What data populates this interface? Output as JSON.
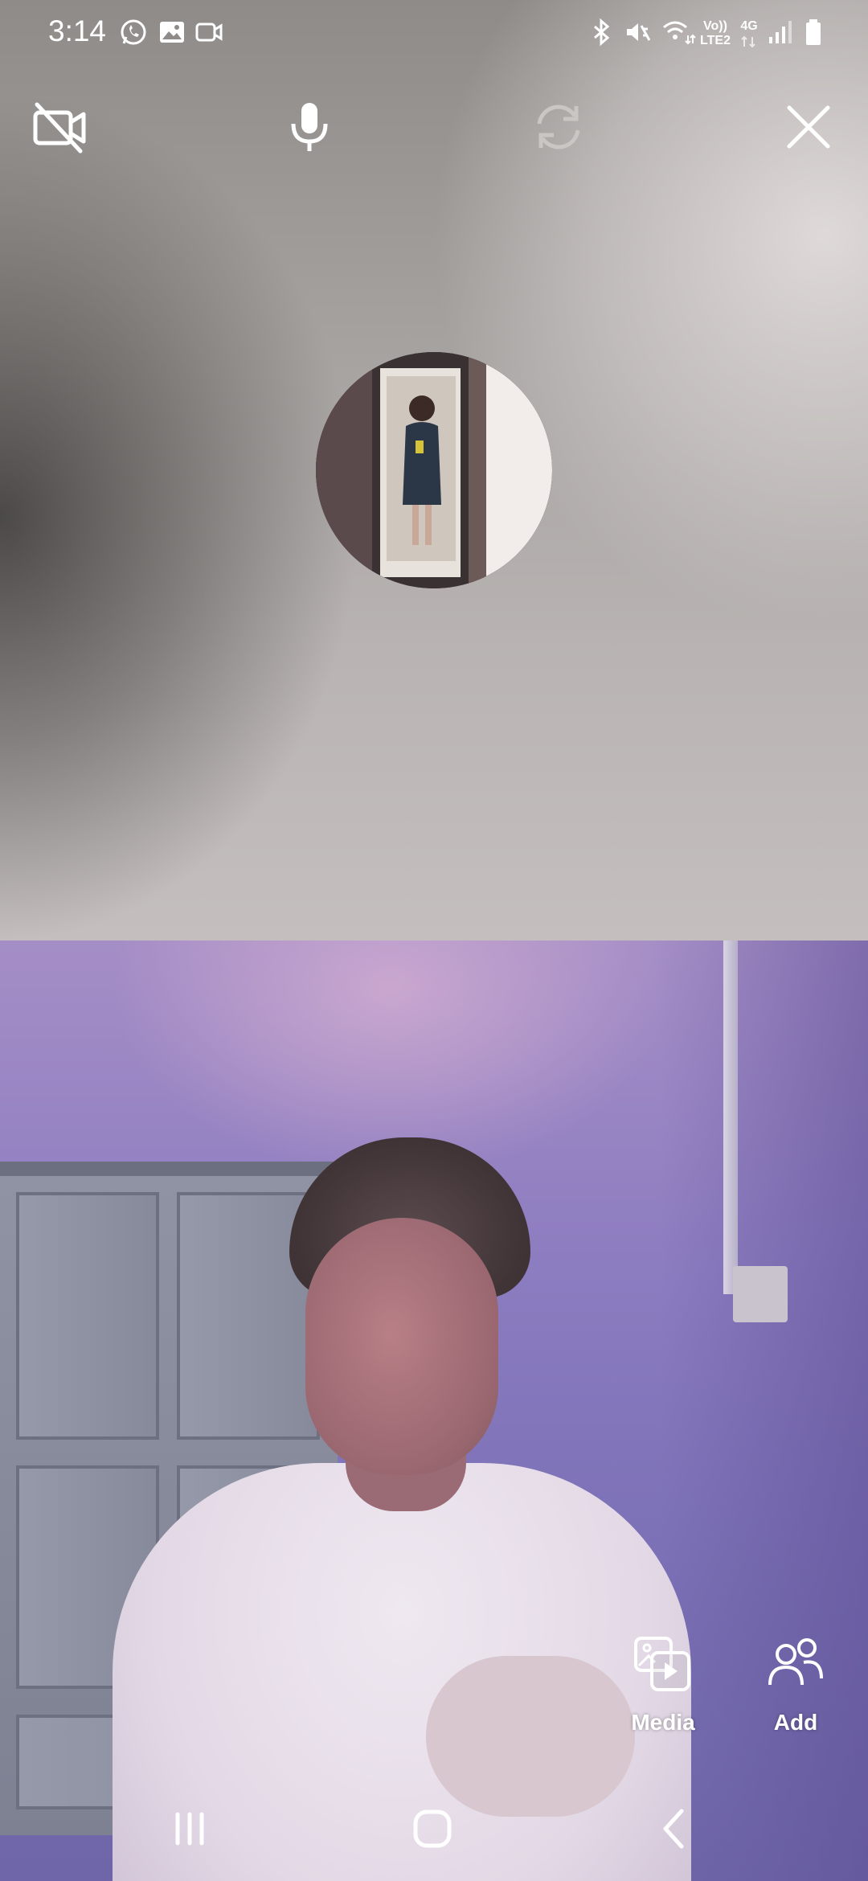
{
  "status_bar": {
    "time": "3:14",
    "network_volte": "Vo))",
    "network_lte": "LTE2",
    "network_gen": "4G",
    "notification_icons": [
      "whatsapp-icon",
      "gallery-icon",
      "video-camera-icon"
    ],
    "system_icons": [
      "bluetooth-icon",
      "mute-icon",
      "wifi-icon",
      "signal-icon",
      "battery-icon"
    ]
  },
  "call_controls": {
    "items": [
      "camera-off-icon",
      "microphone-icon",
      "switch-camera-icon",
      "close-icon"
    ]
  },
  "actions": {
    "media_label": "Media",
    "add_label": "Add"
  },
  "colors": {
    "icon": "#ffffff",
    "icon_disabled": "#c9c6c4"
  }
}
